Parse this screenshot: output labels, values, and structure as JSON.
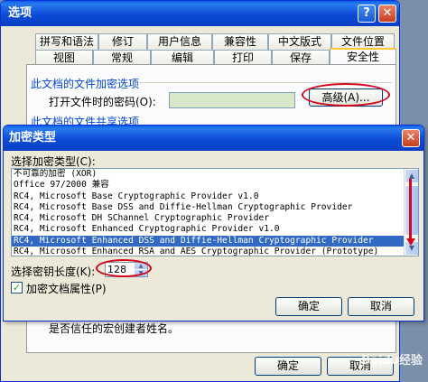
{
  "options_window": {
    "title": "选项",
    "help_glyph": "?",
    "close_glyph": "✕",
    "tabs_row1": [
      "拼写和语法",
      "修订",
      "用户信息",
      "兼容性",
      "中文版式",
      "文件位置"
    ],
    "tabs_row2": [
      "视图",
      "常规",
      "编辑",
      "打印",
      "保存",
      "安全性"
    ],
    "active_tab": "安全性",
    "encrypt_group": "此文档的文件加密选项",
    "open_password_label": "打开文件时的密码(O):",
    "advanced_button": "高级(A)...",
    "share_group": "此文档的文件共享选项",
    "hint_text": "是否信任的宏创建者姓名。",
    "ok_button": "确定",
    "cancel_button": "取消"
  },
  "encrypt_dialog": {
    "title": "加密类型",
    "close_glyph": "✕",
    "type_label": "选择加密类型(C):",
    "types": [
      "不可靠的加密 (XOR)",
      "Office 97/2000 兼容",
      "RC4, Microsoft Base Cryptographic Provider v1.0",
      "RC4, Microsoft Base DSS and Diffie-Hellman Cryptographic Provider",
      "RC4, Microsoft DH SChannel Cryptographic Provider",
      "RC4, Microsoft Enhanced Cryptographic Provider v1.0",
      "RC4, Microsoft Enhanced DSS and Diffie-Hellman Cryptographic Provider",
      "RC4, Microsoft Enhanced RSA and AES Cryptographic Provider (Prototype)"
    ],
    "selected_index": 6,
    "key_length_label": "选择密钥长度(K):",
    "key_length_value": "128",
    "encrypt_props_label": "加密文档属性(P)",
    "encrypt_props_checked": true,
    "ok_button": "确定",
    "cancel_button": "取消",
    "scroll_up_glyph": "▲",
    "scroll_down_glyph": "▼",
    "check_glyph": "✓"
  },
  "watermark": "Baidu经验",
  "colors": {
    "titlebar": "#0a3fc4",
    "group_label": "#0046d5",
    "selection": "#316ac5",
    "annotation": "#d2081e"
  }
}
